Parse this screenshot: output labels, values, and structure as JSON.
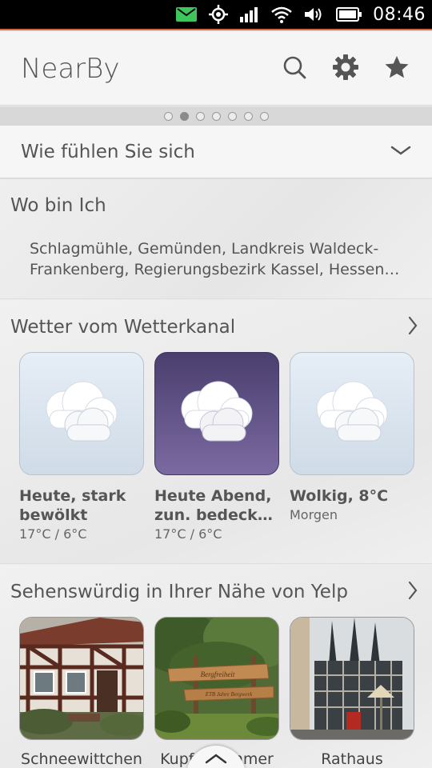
{
  "status_bar": {
    "time": "08:46",
    "icons": [
      "mail-icon",
      "gps-icon",
      "signal-icon",
      "wifi-icon",
      "volume-icon",
      "battery-icon"
    ],
    "mail_color": "#3ec55c"
  },
  "header": {
    "title": "NearBy",
    "actions": [
      "search-icon",
      "gear-icon",
      "star-icon"
    ]
  },
  "pager": {
    "count": 7,
    "active_index": 1
  },
  "mood": {
    "label": "Wie fühlen Sie sich"
  },
  "location": {
    "title": "Wo bin Ich",
    "line1": "Schlagmühle, Gemünden, Landkreis Waldeck-",
    "line2": "Frankenberg, Regierungsbezirk Kassel, Hessen…"
  },
  "weather": {
    "title": "Wetter vom Wetterkanal",
    "cards": [
      {
        "title": "Heute, stark bewölkt",
        "sub": "17°C / 6°C",
        "variant": "light"
      },
      {
        "title": "Heute Abend, zun. bedeck…",
        "sub": "17°C / 6°C",
        "variant": "dark"
      },
      {
        "title": "Wolkig, 8°C",
        "sub": "Morgen",
        "variant": "light"
      }
    ]
  },
  "yelp": {
    "title": "Sehenswürdig in Ihrer Nähe von Yelp",
    "places": [
      {
        "label": "Schneewittchen"
      },
      {
        "label": "Kupferhammer",
        "sign_text_1": "Bergfreiheit",
        "sign_text_2": "ETB Jahre Bergwerk"
      },
      {
        "label": "Rathaus"
      }
    ]
  },
  "colors": {
    "accent_line": "#e0643a",
    "dark_card": "#5a4d80"
  }
}
